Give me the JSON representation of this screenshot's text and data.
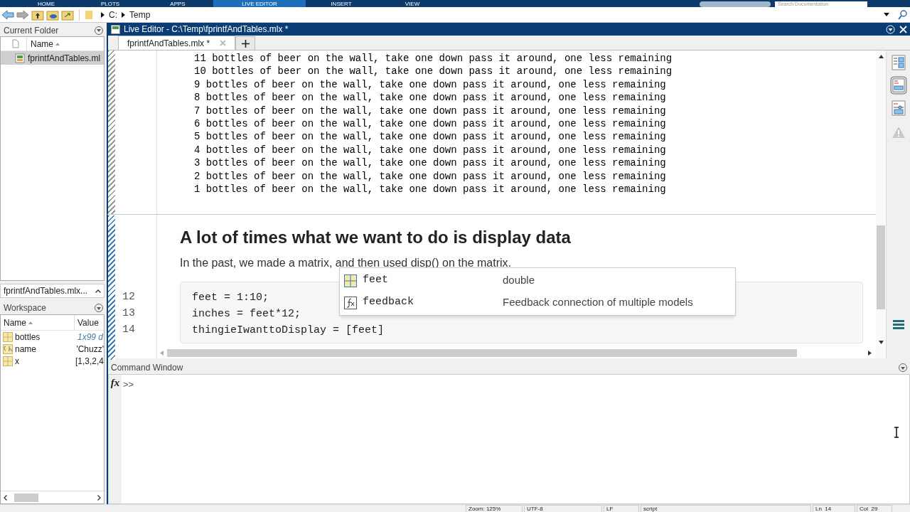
{
  "ribbon": {
    "tabs": [
      {
        "label": "HOME",
        "selected": false
      },
      {
        "label": "PLOTS",
        "selected": false
      },
      {
        "label": "APPS",
        "selected": false
      },
      {
        "label": "LIVE EDITOR",
        "selected": true
      },
      {
        "label": "INSERT",
        "selected": false
      },
      {
        "label": "VIEW",
        "selected": false
      }
    ],
    "search": {
      "placeholder": "Search Documentation"
    }
  },
  "address_bar": {
    "path": [
      "C:",
      "Temp"
    ]
  },
  "current_folder": {
    "title": "Current Folder",
    "column": "Name",
    "files": [
      {
        "name": "fprintfAndTables.ml",
        "selected": true
      }
    ],
    "details": "fprintfAndTables.mlx..."
  },
  "workspace": {
    "title": "Workspace",
    "columns": [
      "Name",
      "Value"
    ],
    "variables": [
      {
        "name": "bottles",
        "value": "1x99 d",
        "kind": "matrix"
      },
      {
        "name": "name",
        "value": "'Chuzz'",
        "kind": "char"
      },
      {
        "name": "x",
        "value": "[1,3,2,4",
        "kind": "matrix"
      }
    ]
  },
  "editor": {
    "title": "Live Editor - C:\\Temp\\fprintfAndTables.mlx *",
    "tabs": [
      {
        "label": "fprintfAndTables.mlx *",
        "selected": true
      }
    ],
    "output_lines": [
      "11 bottles of beer on the wall, take one down pass it around, one less remaining",
      "10 bottles of beer on the wall, take one down pass it around, one less remaining",
      "9 bottles of beer on the wall, take one down pass it around, one less remaining",
      "8 bottles of beer on the wall, take one down pass it around, one less remaining",
      "7 bottles of beer on the wall, take one down pass it around, one less remaining",
      "6 bottles of beer on the wall, take one down pass it around, one less remaining",
      "5 bottles of beer on the wall, take one down pass it around, one less remaining",
      "4 bottles of beer on the wall, take one down pass it around, one less remaining",
      "3 bottles of beer on the wall, take one down pass it around, one less remaining",
      "2 bottles of beer on the wall, take one down pass it around, one less remaining",
      "1 bottles of beer on the wall, take one down pass it around, one less remaining"
    ],
    "heading": "A lot of times what we want to do is display data",
    "paragraph": "In the past, we made a matrix, and then used disp() on the matrix.",
    "code": [
      {
        "line": "12",
        "text": "feet = 1:10;"
      },
      {
        "line": "13",
        "text": "inches = feet*12;"
      },
      {
        "line": "14",
        "text": "thingieIwanttoDisplay = [feet]"
      }
    ],
    "autocomplete": [
      {
        "name": "feet",
        "detail": "double",
        "kind": "variable"
      },
      {
        "name": "feedback",
        "detail": "Feedback connection of multiple models",
        "kind": "function"
      }
    ]
  },
  "command_window": {
    "title": "Command Window",
    "function_button": "fx",
    "prompt": ">>"
  },
  "status_bar": [
    "Zoom: 125%",
    "UTF-8",
    "LF",
    "script",
    "Ln  14",
    "Col  29"
  ]
}
